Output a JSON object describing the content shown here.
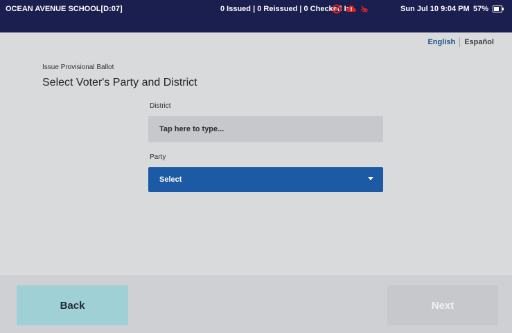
{
  "status_bar": {
    "location": "OCEAN AVENUE SCHOOL[D:07]",
    "counts": "0 Issued | 0 Reissued | 0 Checked In",
    "datetime": "Sun Jul 10  9:04 PM",
    "battery": "57%",
    "icons": [
      "no-entry-icon",
      "cloud-alert-icon",
      "wifi-off-icon",
      "battery-icon"
    ]
  },
  "language": {
    "english": "English",
    "spanish": "Español"
  },
  "page": {
    "breadcrumb": "Issue Provisional Ballot",
    "title": "Select Voter's Party and District"
  },
  "form": {
    "district_label": "District",
    "district_placeholder": "Tap here to type...",
    "party_label": "Party",
    "party_selected": "Select"
  },
  "footer": {
    "back_label": "Back",
    "next_label": "Next"
  },
  "colors": {
    "statusbar": "#1a1f4f",
    "select": "#1c5aa6",
    "back": "#9fd0d6",
    "alert": "#e02424"
  }
}
